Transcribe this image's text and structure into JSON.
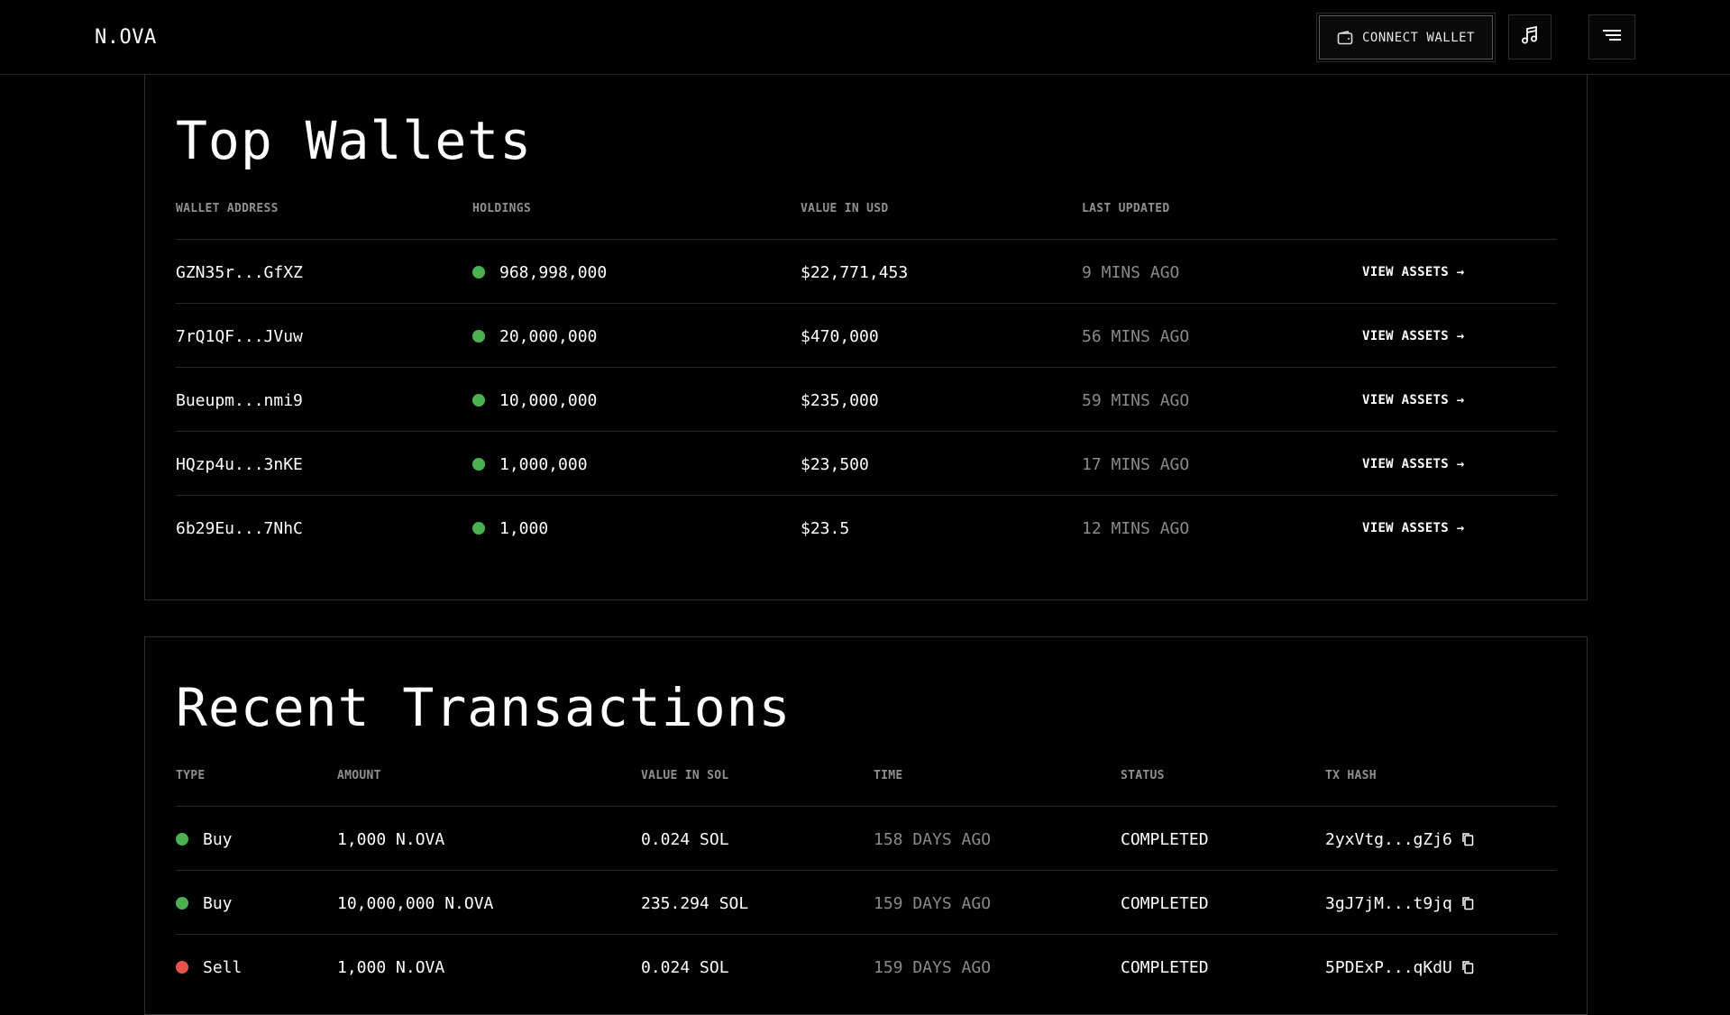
{
  "header": {
    "brand": "N.OVA",
    "connect_label": "CONNECT WALLET"
  },
  "icons": {
    "wallet": "wallet-icon",
    "music": "music-note-icon",
    "menu": "menu-icon",
    "copy": "copy-icon",
    "arrow": "arrow-right-icon"
  },
  "colors": {
    "background": "#000000",
    "buy": "#4caf50",
    "sell": "#e5534b",
    "muted": "#8a8a8a"
  },
  "top_wallets": {
    "title": "Top Wallets",
    "columns": [
      "WALLET ADDRESS",
      "HOLDINGS",
      "VALUE IN USD",
      "LAST UPDATED"
    ],
    "rows": [
      {
        "address": "GZN35r...GfXZ",
        "holdings": "968,998,000",
        "usd": "$22,771,453",
        "updated": "9 MINS AGO",
        "action": "VIEW ASSETS →"
      },
      {
        "address": "7rQ1QF...JVuw",
        "holdings": "20,000,000",
        "usd": "$470,000",
        "updated": "56 MINS AGO",
        "action": "VIEW ASSETS →"
      },
      {
        "address": "Bueupm...nmi9",
        "holdings": "10,000,000",
        "usd": "$235,000",
        "updated": "59 MINS AGO",
        "action": "VIEW ASSETS →"
      },
      {
        "address": "HQzp4u...3nKE",
        "holdings": "1,000,000",
        "usd": "$23,500",
        "updated": "17 MINS AGO",
        "action": "VIEW ASSETS →"
      },
      {
        "address": "6b29Eu...7NhC",
        "holdings": "1,000",
        "usd": "$23.5",
        "updated": "12 MINS AGO",
        "action": "VIEW ASSETS →"
      }
    ]
  },
  "recent_transactions": {
    "title": "Recent Transactions",
    "columns": [
      "TYPE",
      "AMOUNT",
      "VALUE IN SOL",
      "TIME",
      "STATUS",
      "TX HASH"
    ],
    "rows": [
      {
        "type": "Buy",
        "amount": "1,000 N.OVA",
        "sol": "0.024 SOL",
        "time": "158 DAYS AGO",
        "status": "COMPLETED",
        "hash": "2yxVtg...gZj6"
      },
      {
        "type": "Buy",
        "amount": "10,000,000 N.OVA",
        "sol": "235.294 SOL",
        "time": "159 DAYS AGO",
        "status": "COMPLETED",
        "hash": "3gJ7jM...t9jq"
      },
      {
        "type": "Sell",
        "amount": "1,000 N.OVA",
        "sol": "0.024 SOL",
        "time": "159 DAYS AGO",
        "status": "COMPLETED",
        "hash": "5PDExP...qKdU"
      }
    ]
  }
}
